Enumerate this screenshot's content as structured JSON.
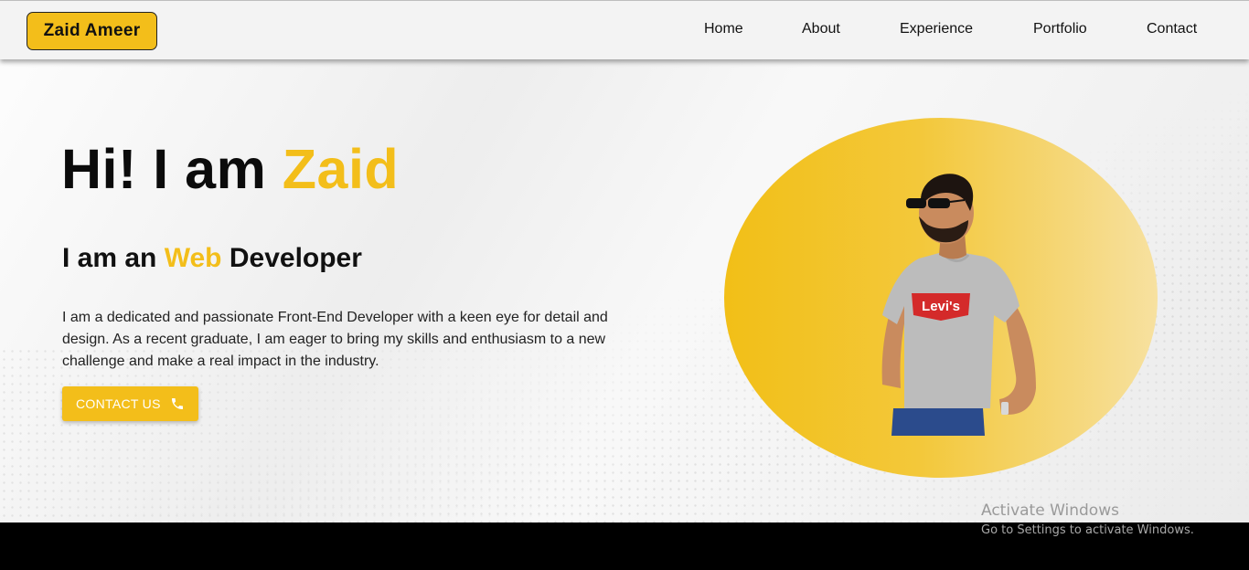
{
  "header": {
    "logo": "Zaid Ameer",
    "nav": [
      "Home",
      "About",
      "Experience",
      "Portfolio",
      "Contact"
    ]
  },
  "hero": {
    "title_prefix": "Hi! I am ",
    "title_name": "Zaid",
    "subtitle_prefix": "I am an ",
    "subtitle_accent": "Web",
    "subtitle_suffix": " Developer",
    "description": "I am a dedicated and passionate Front-End Developer with a keen eye for detail and design. As a recent graduate, I am eager to bring my skills and enthusiasm to a new challenge and make a real impact in the industry.",
    "cta_label": "CONTACT US",
    "cta_icon": "phone-icon",
    "image_subject": "person-photo",
    "shirt_text": "Levi's"
  },
  "watermark": {
    "title": "Activate Windows",
    "subtitle": "Go to Settings to activate Windows."
  },
  "colors": {
    "accent": "#f3be1a",
    "text": "#0b0b0b",
    "background": "#f1f1f1",
    "taskbar": "#000000"
  }
}
